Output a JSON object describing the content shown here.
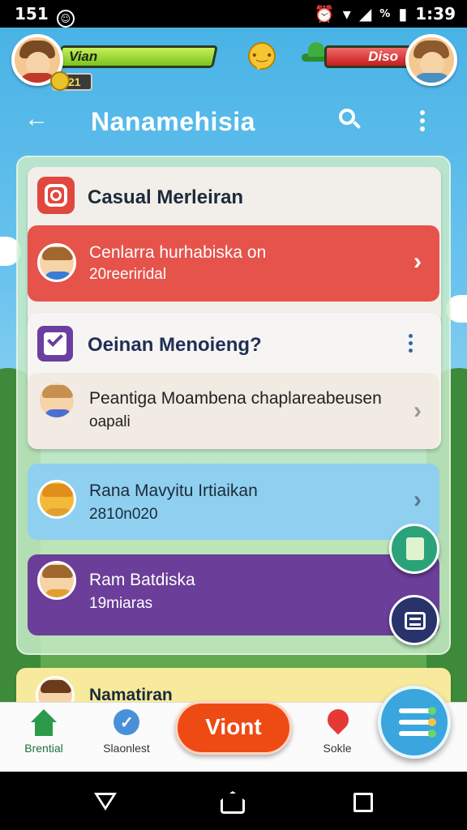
{
  "status_bar": {
    "time_left": "151",
    "battery_percent": "%",
    "clock": "1:39"
  },
  "hud": {
    "player_name": "Vian",
    "player_level": "21",
    "opponent_name": "Diso"
  },
  "header": {
    "title": "Nanamehisia"
  },
  "card_header": {
    "title": "Casual Merleiran"
  },
  "item_red": {
    "line1": "Cenlarra hurhabiska  on",
    "line2": "20reeriridal"
  },
  "card_question": {
    "title": "Oeinan Menoieng?"
  },
  "item_beige": {
    "line1": "Peantiga Moambena chaplareabeusen",
    "line2": "oapali"
  },
  "item_blue": {
    "line1": "Rana Mavyitu Irtiaikan",
    "line2": "2810n020"
  },
  "item_purple": {
    "line1": "Ram Batdiska",
    "line2": "19miaras"
  },
  "card_yellow": {
    "title": "Namatiran"
  },
  "bottom_nav": {
    "home_label": "Brential",
    "messages_label": "Slaonlest",
    "play_label": "Viont",
    "social_label": "Sokle"
  },
  "colors": {
    "accent": "#ee4a13",
    "header_bg": "#49b3e6",
    "red": "#e5534b",
    "purple": "#6a3e99",
    "blue": "#8fd0f0"
  }
}
